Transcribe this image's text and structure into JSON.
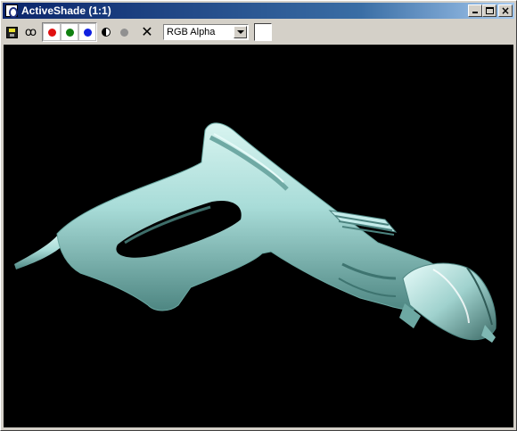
{
  "window": {
    "title": "ActiveShade (1:1)"
  },
  "icons": {
    "app": "activeshade-icon",
    "save": "save-icon",
    "clone": "clone-icon",
    "red": "red-channel-icon",
    "green": "green-channel-icon",
    "blue": "blue-channel-icon",
    "mono": "monochrome-icon",
    "alpha": "alpha-channel-icon",
    "clear": "clear-icon"
  },
  "toolbar": {
    "channel_display": "RGB Alpha"
  },
  "colors": {
    "red_channel": "#e01010",
    "green_channel": "#108010",
    "blue_channel": "#1020e0",
    "model": "#a8dcd8",
    "background_swatch": "#ffffff"
  }
}
